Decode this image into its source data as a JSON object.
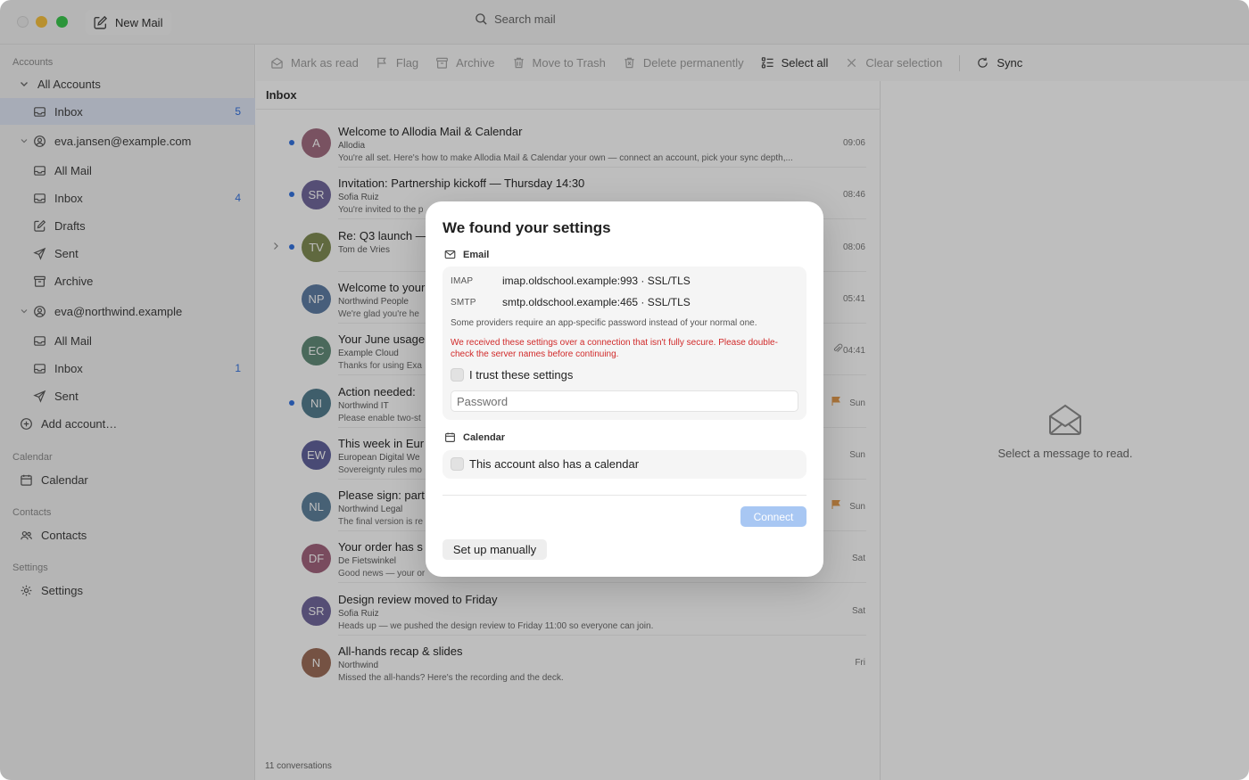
{
  "titlebar": {
    "new_mail_label": "New Mail",
    "search_placeholder": "Search mail"
  },
  "sidebar": {
    "accounts_header": "Accounts",
    "all_accounts": "All Accounts",
    "all_inbox": {
      "label": "Inbox",
      "count": "5"
    },
    "account1": {
      "email": "eva.jansen@example.com",
      "items": [
        {
          "label": "All Mail",
          "count": ""
        },
        {
          "label": "Inbox",
          "count": "4"
        },
        {
          "label": "Drafts",
          "count": ""
        },
        {
          "label": "Sent",
          "count": ""
        },
        {
          "label": "Archive",
          "count": ""
        }
      ]
    },
    "account2": {
      "email": "eva@northwind.example",
      "items": [
        {
          "label": "All Mail",
          "count": ""
        },
        {
          "label": "Inbox",
          "count": "1"
        },
        {
          "label": "Sent",
          "count": ""
        }
      ]
    },
    "add_account": "Add account…",
    "calendar_header": "Calendar",
    "calendar_item": "Calendar",
    "contacts_header": "Contacts",
    "contacts_item": "Contacts",
    "settings_header": "Settings",
    "settings_item": "Settings"
  },
  "toolbar": {
    "mark_read": "Mark as read",
    "flag": "Flag",
    "archive": "Archive",
    "trash": "Move to Trash",
    "delete": "Delete permanently",
    "select_all": "Select all",
    "clear_selection": "Clear selection",
    "sync": "Sync"
  },
  "list": {
    "title": "Inbox",
    "footer": "11 conversations",
    "messages": [
      {
        "initials": "A",
        "color": "#a06a7e",
        "subject": "Welcome to Allodia Mail & Calendar",
        "from": "Allodia",
        "preview": "You're all set. Here's how to make Allodia Mail & Calendar your own — connect an account, pick your sync depth,...",
        "time": "09:06",
        "unread": true
      },
      {
        "initials": "SR",
        "color": "#6e659a",
        "subject": "Invitation: Partnership kickoff — Thursday 14:30",
        "from": "Sofia Ruiz",
        "preview": "You're invited to the p",
        "time": "08:46",
        "unread": true
      },
      {
        "initials": "TV",
        "color": "#7d8a50",
        "subject": "Re: Q3 launch —",
        "from": "Tom de Vries",
        "preview": "",
        "time": "08:06",
        "unread": true
      },
      {
        "initials": "NP",
        "color": "#5b7aa2",
        "subject": "Welcome to your",
        "from": "Northwind People",
        "preview": "We're glad you're he",
        "time": "05:41",
        "unread": false
      },
      {
        "initials": "EC",
        "color": "#5f8a76",
        "subject": "Your June usage",
        "from": "Example Cloud",
        "preview": "Thanks for using Exa",
        "time": "04:41",
        "unread": false
      },
      {
        "initials": "NI",
        "color": "#4f7b8c",
        "subject": "Action needed:",
        "from": "Northwind IT",
        "preview": "Please enable two-st",
        "time": "Sun",
        "unread": true
      },
      {
        "initials": "EW",
        "color": "#5d5f9a",
        "subject": "This week in Eur",
        "from": "European Digital We",
        "preview": "Sovereignty rules mo",
        "time": "Sun",
        "unread": false
      },
      {
        "initials": "NL",
        "color": "#5b7f9a",
        "subject": "Please sign: part",
        "from": "Northwind Legal",
        "preview": "The final version is re",
        "time": "Sun",
        "unread": false
      },
      {
        "initials": "DF",
        "color": "#a0607a",
        "subject": "Your order has s",
        "from": "De Fietswinkel",
        "preview": "Good news — your or",
        "time": "Sat",
        "unread": false
      },
      {
        "initials": "SR",
        "color": "#6e659a",
        "subject": "Design review moved to Friday",
        "from": "Sofia Ruiz",
        "preview": "Heads up — we pushed the design review to Friday 11:00 so everyone can join.",
        "time": "Sat",
        "unread": false
      },
      {
        "initials": "N",
        "color": "#9a6a55",
        "subject": "All-hands recap & slides",
        "from": "Northwind",
        "preview": "Missed the all-hands? Here's the recording and the deck.",
        "time": "Fri",
        "unread": false
      }
    ]
  },
  "reader": {
    "empty_text": "Select a message to read."
  },
  "modal": {
    "title": "We found your settings",
    "email_section": "Email",
    "imap_key": "IMAP",
    "imap_value": "imap.oldschool.example:993 · SSL/TLS",
    "smtp_key": "SMTP",
    "smtp_value": "smtp.oldschool.example:465 · SSL/TLS",
    "note": "Some providers require an app-specific password instead of your normal one.",
    "warning": "We received these settings over a connection that isn't fully secure. Please double-check the server names before continuing.",
    "trust_label": "I trust these settings",
    "password_placeholder": "Password",
    "calendar_section": "Calendar",
    "calendar_check": "This account also has a calendar",
    "connect_label": "Connect",
    "manual_label": "Set up manually"
  },
  "colors": {
    "accent": "#2f6fe0",
    "warning": "#d12a2a",
    "flag": "#e59a4a",
    "connect_disabled": "#a8c7f3"
  }
}
